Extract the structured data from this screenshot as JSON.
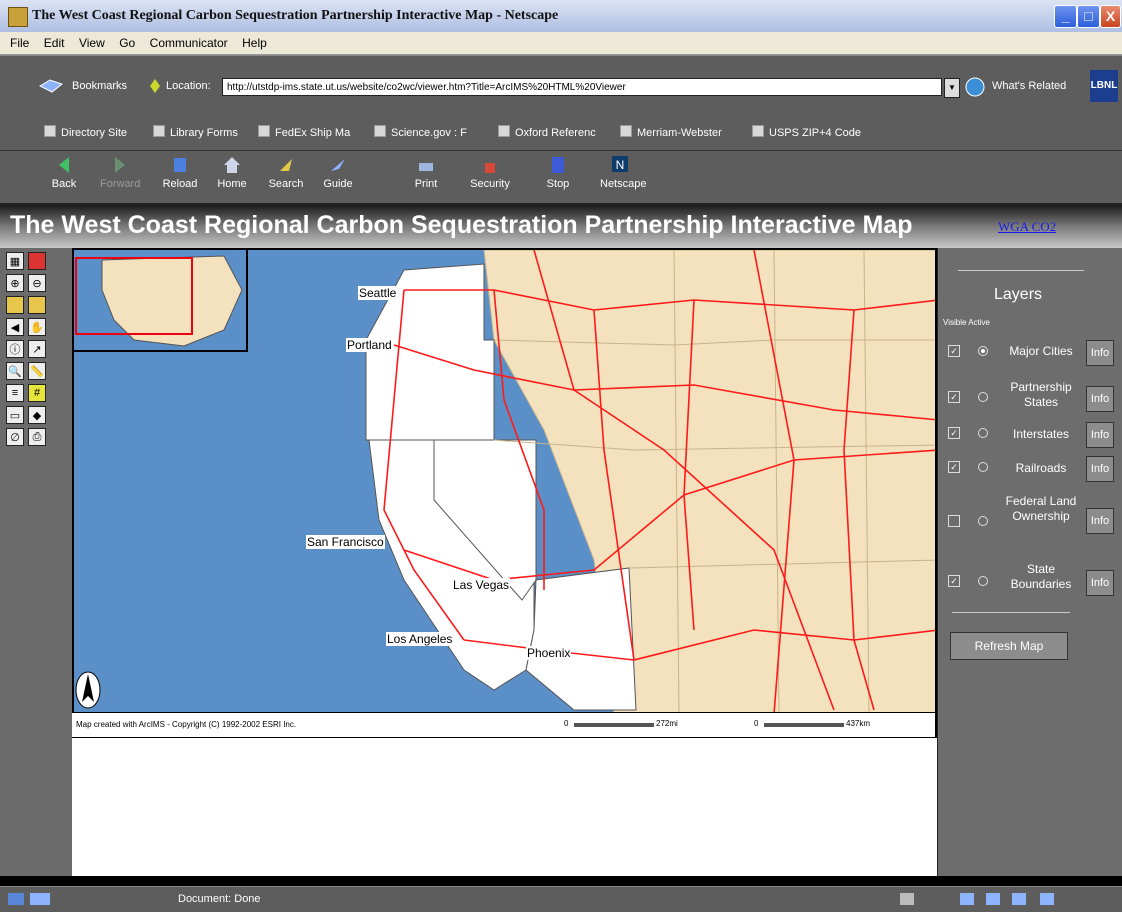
{
  "window": {
    "title": "The West Coast Regional Carbon Sequestration Partnership Interactive Map - Netscape",
    "minimize": "_",
    "maximize": "□",
    "close": "X"
  },
  "menu": [
    "File",
    "Edit",
    "View",
    "Go",
    "Communicator",
    "Help"
  ],
  "location": {
    "bookmarks_label": "Bookmarks",
    "location_label": "Location:",
    "url": "http://utstdp-ims.state.ut.us/website/co2wc/viewer.htm?Title=ArcIMS%20HTML%20Viewer",
    "whats_related": "What's Related",
    "logo_text": "LBNL"
  },
  "personal_toolbar": [
    "Directory Site",
    "Library Forms",
    "FedEx Ship Ma",
    "Science.gov : F",
    "Oxford Referenc",
    "Merriam-Webster",
    "USPS ZIP+4 Code"
  ],
  "nav_toolbar": [
    {
      "label": "Back",
      "icon": "back-icon",
      "enabled": true
    },
    {
      "label": "Forward",
      "icon": "forward-icon",
      "enabled": false
    },
    {
      "label": "Reload",
      "icon": "reload-icon",
      "enabled": true
    },
    {
      "label": "Home",
      "icon": "home-icon",
      "enabled": true
    },
    {
      "label": "Search",
      "icon": "search-icon",
      "enabled": true
    },
    {
      "label": "Guide",
      "icon": "guide-icon",
      "enabled": true
    },
    {
      "label": "Print",
      "icon": "print-icon",
      "enabled": true
    },
    {
      "label": "Security",
      "icon": "security-icon",
      "enabled": true
    },
    {
      "label": "Stop",
      "icon": "stop-icon",
      "enabled": true
    },
    {
      "label": "Netscape",
      "icon": "netscape-icon",
      "enabled": true
    }
  ],
  "page": {
    "title": "The West Coast Regional Carbon Sequestration Partnership Interactive Map",
    "link": "WGA CO2"
  },
  "map": {
    "cities": [
      "Seattle",
      "Portland",
      "San Francisco",
      "Las Vegas",
      "Los Angeles",
      "Phoenix"
    ],
    "copyright": "Map created with ArcIMS - Copyright (C) 1992-2002 ESRI Inc.",
    "scale_a_start": "0",
    "scale_a_end": "272mi",
    "scale_b_start": "0",
    "scale_b_end": "437km",
    "ocean_color": "#5b8fc7",
    "land_color": "#f3e2bd",
    "road_color": "#ff1a1a"
  },
  "layers": {
    "title": "Layers",
    "header": "Visible Active",
    "items": [
      {
        "name": "Major Cities",
        "visible": true,
        "active": true
      },
      {
        "name": "Partnership States",
        "visible": true,
        "active": false
      },
      {
        "name": "Interstates",
        "visible": true,
        "active": false
      },
      {
        "name": "Railroads",
        "visible": true,
        "active": false
      },
      {
        "name": "Federal Land Ownership",
        "visible": false,
        "active": false
      },
      {
        "name": "State Boundaries",
        "visible": true,
        "active": false
      }
    ],
    "info_label": "Info",
    "refresh_label": "Refresh Map"
  },
  "status": {
    "text": "Document: Done"
  }
}
